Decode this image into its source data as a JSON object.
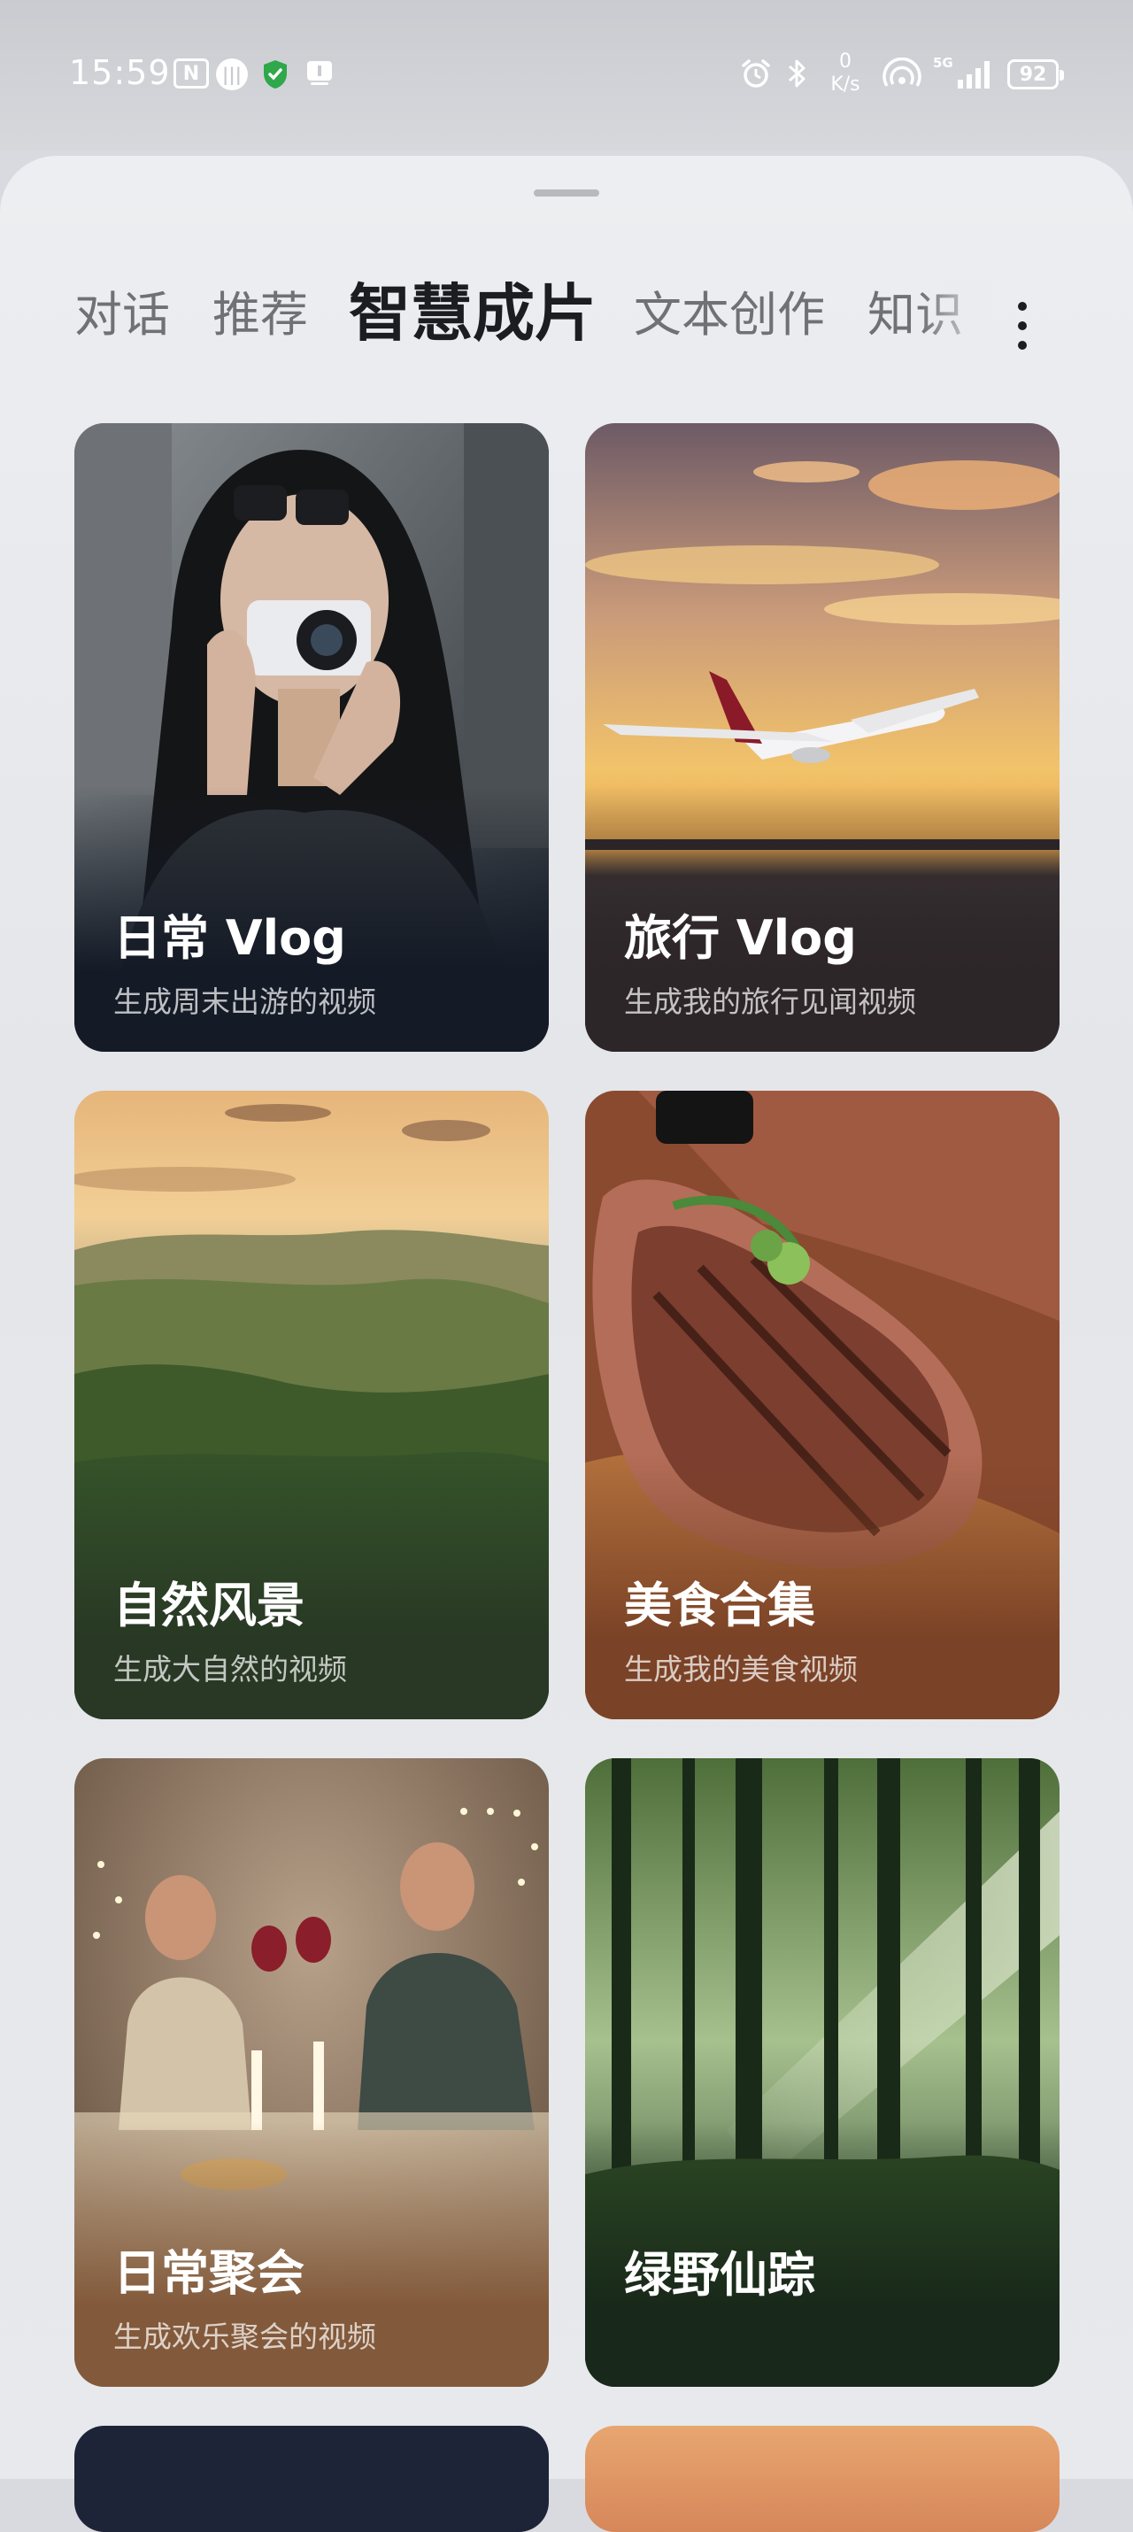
{
  "status_bar": {
    "time": "15:59",
    "nfc_label": "N",
    "net_speed_value": "0",
    "net_speed_unit": "K/s",
    "signal_label": "5G",
    "battery": "92"
  },
  "tabs": [
    {
      "label": "对话",
      "active": false
    },
    {
      "label": "推荐",
      "active": false
    },
    {
      "label": "智慧成片",
      "active": true
    },
    {
      "label": "文本创作",
      "active": false
    },
    {
      "label": "知识",
      "active": false
    }
  ],
  "cards": [
    {
      "title": "日常 Vlog",
      "subtitle": "生成周末出游的视频"
    },
    {
      "title": "旅行 Vlog",
      "subtitle": "生成我的旅行见闻视频"
    },
    {
      "title": "自然风景",
      "subtitle": "生成大自然的视频"
    },
    {
      "title": "美食合集",
      "subtitle": "生成我的美食视频"
    },
    {
      "title": "日常聚会",
      "subtitle": "生成欢乐聚会的视频"
    },
    {
      "title": "绿野仙踪",
      "subtitle": ""
    }
  ],
  "icons": {
    "more": "more-vertical-icon"
  }
}
